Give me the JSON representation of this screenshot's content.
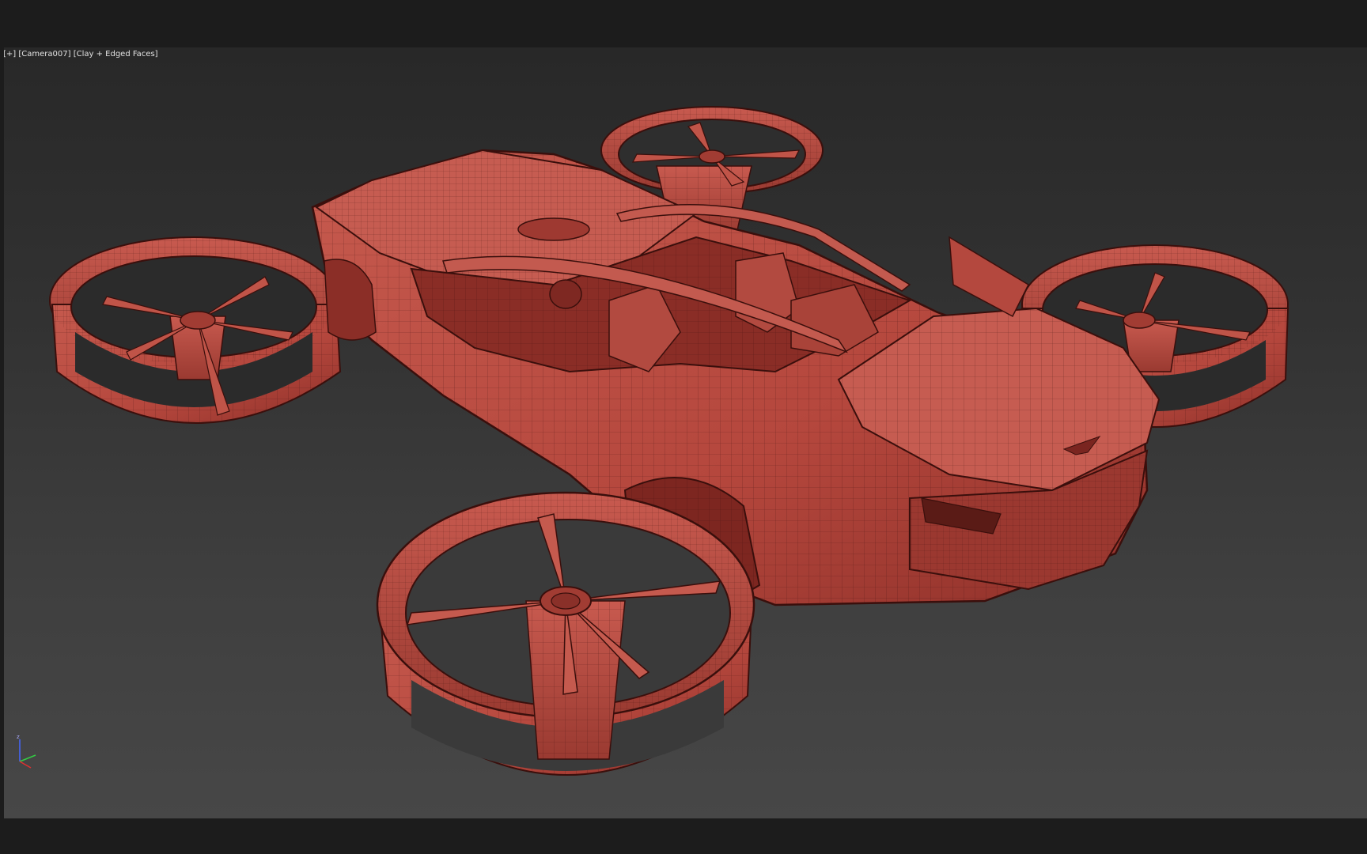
{
  "viewport": {
    "label_plus": "[+]",
    "label_camera": "[Camera007]",
    "label_shading": "[Clay + Edged Faces]"
  },
  "axis_gizmo": {
    "z_label": "z"
  },
  "icons": {
    "axis": "axis-tripod-icon"
  },
  "colors": {
    "clay": "#b5473d",
    "clay_light": "#cc5e53",
    "clay_dark": "#7a2520",
    "edge": "#3a0f0c",
    "viewport_top": "#282828",
    "viewport_bottom": "#474747",
    "frame": "#1c1c1c"
  }
}
